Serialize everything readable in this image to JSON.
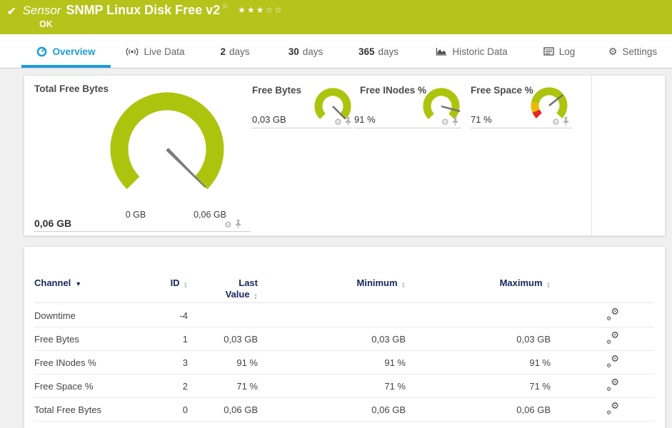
{
  "header": {
    "check": "✔",
    "kind": "Sensor",
    "title": "SNMP Linux Disk Free v2",
    "flag": "⚐",
    "stars": "★★★☆☆",
    "status": "OK"
  },
  "tabs": [
    {
      "label": "Overview"
    },
    {
      "label": "Live Data"
    },
    {
      "num": "2",
      "label": "days"
    },
    {
      "num": "30",
      "label": "days"
    },
    {
      "num": "365",
      "label": "days"
    },
    {
      "label": "Historic Data"
    },
    {
      "label": "Log"
    },
    {
      "label": "Settings"
    }
  ],
  "gauges": {
    "main": {
      "title": "Total Free Bytes",
      "value": "0,06 GB",
      "scale_min": "0 GB",
      "scale_max": "0,06 GB"
    },
    "mini": [
      {
        "title": "Free Bytes",
        "value": "0,03 GB"
      },
      {
        "title": "Free INodes %",
        "value": "91 %"
      },
      {
        "title": "Free Space %",
        "value": "71 %"
      }
    ]
  },
  "table": {
    "headers": {
      "channel": "Channel",
      "id": "ID",
      "last_line1": "Last",
      "last_line2": "Value",
      "minimum": "Minimum",
      "maximum": "Maximum"
    },
    "rows": [
      {
        "channel": "Downtime",
        "id": "-4",
        "last": "",
        "min": "",
        "max": ""
      },
      {
        "channel": "Free Bytes",
        "id": "1",
        "last": "0,03 GB",
        "min": "0,03 GB",
        "max": "0,03 GB"
      },
      {
        "channel": "Free INodes %",
        "id": "3",
        "last": "91 %",
        "min": "91 %",
        "max": "91 %"
      },
      {
        "channel": "Free Space %",
        "id": "2",
        "last": "71 %",
        "min": "71 %",
        "max": "71 %"
      },
      {
        "channel": "Total Free Bytes",
        "id": "0",
        "last": "0,06 GB",
        "min": "0,06 GB",
        "max": "0,06 GB"
      }
    ]
  },
  "icons": {
    "gear": "⚙",
    "sort_up": "▲",
    "sort_down": "▼",
    "sort_active": "▼"
  },
  "colors": {
    "green": "#b5c31a",
    "gauge": "#adc40e",
    "blue": "#1b9dd9",
    "navy": "#18265c",
    "red": "#e5281e",
    "yellow": "#edb903"
  }
}
